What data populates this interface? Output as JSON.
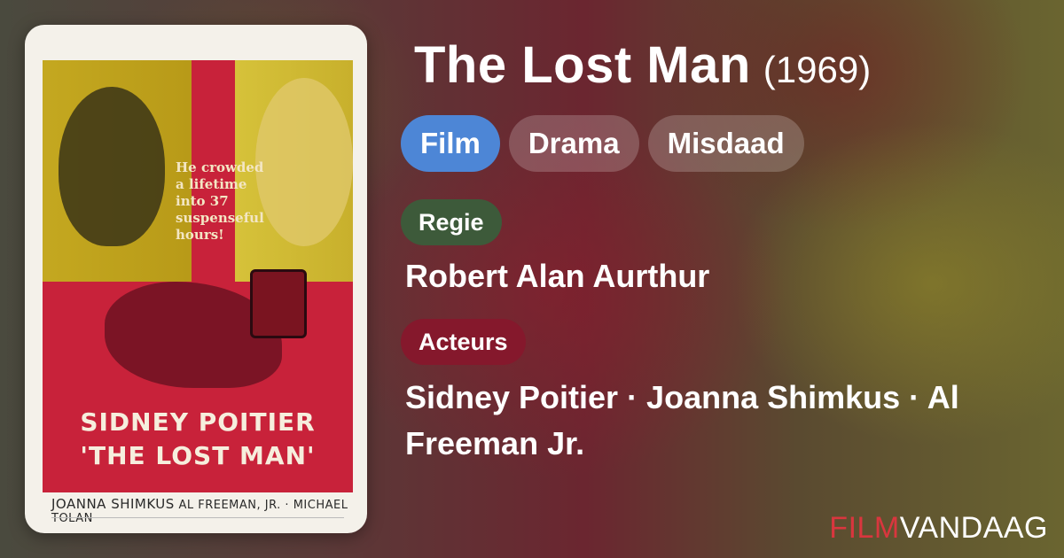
{
  "film": {
    "title": "The Lost Man",
    "year": "(1969)"
  },
  "genres": [
    "Film",
    "Drama",
    "Misdaad"
  ],
  "colors": {
    "primary_tag": "#4d86d6",
    "regie_label": "#3d5a3a",
    "acteurs_label": "#85182c",
    "brand_red": "#d9363e"
  },
  "director": {
    "label": "Regie",
    "value": "Robert Alan Aurthur"
  },
  "actors": {
    "label": "Acteurs",
    "value": "Sidney Poitier · Joanna Shimkus · Al Freeman Jr."
  },
  "poster": {
    "tagline": "He crowded a lifetime into 37 suspenseful hours!",
    "star": "SIDNEY POITIER",
    "title": "'THE LOST MAN'",
    "credits_a": "JOANNA SHIMKUS",
    "credits_b": "AL FREEMAN, JR. · MICHAEL TOLAN"
  },
  "brand": {
    "part1": "FILM",
    "part2": "VANDAAG"
  }
}
